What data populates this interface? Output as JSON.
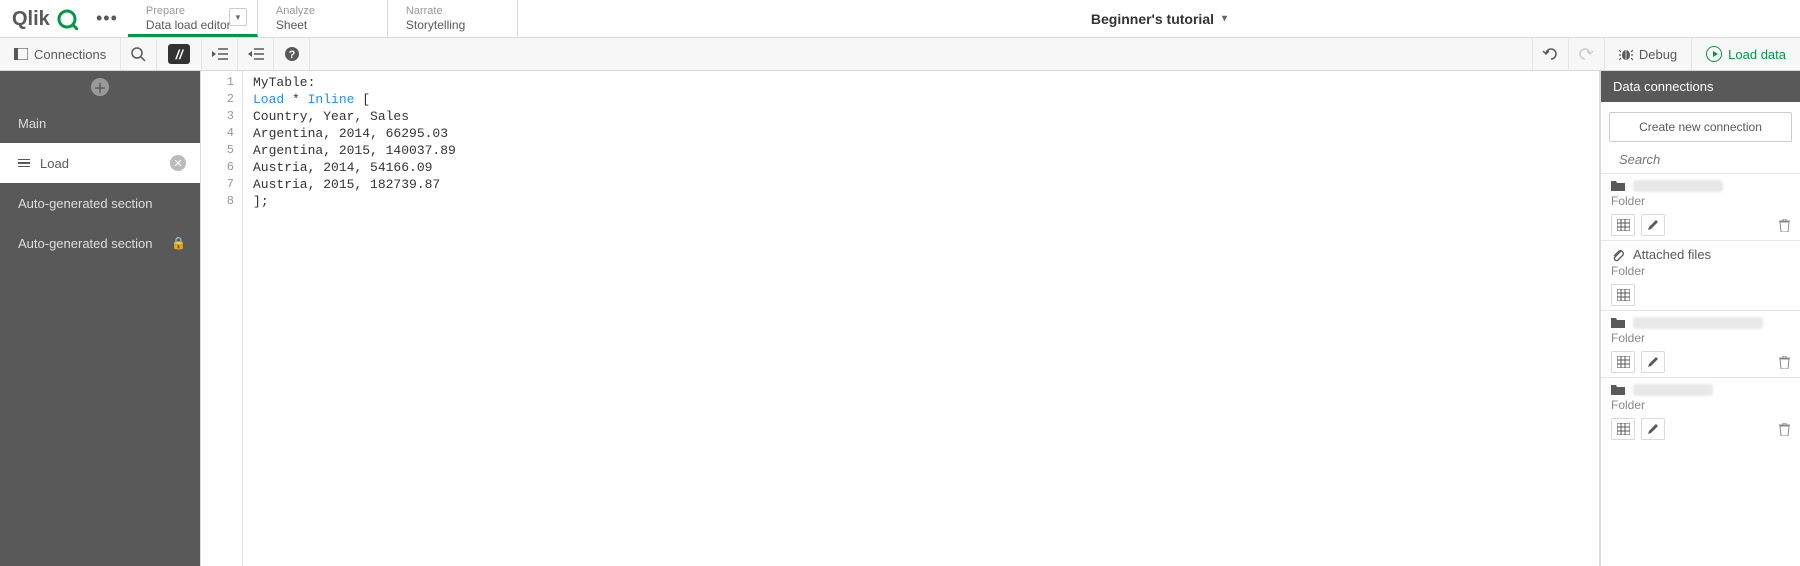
{
  "header": {
    "tabs": [
      {
        "small": "Prepare",
        "big": "Data load editor",
        "active": true,
        "hasChevron": true
      },
      {
        "small": "Analyze",
        "big": "Sheet",
        "active": false,
        "hasChevron": false
      },
      {
        "small": "Narrate",
        "big": "Storytelling",
        "active": false,
        "hasChevron": false
      }
    ],
    "title": "Beginner's tutorial"
  },
  "toolbar": {
    "connections": "Connections",
    "debug": "Debug",
    "loadData": "Load data"
  },
  "sections": {
    "items": [
      {
        "label": "Main",
        "selected": false
      },
      {
        "label": "Load",
        "selected": true
      },
      {
        "label": "Auto-generated section",
        "selected": false
      },
      {
        "label": "Auto-generated section",
        "selected": false,
        "locked": true
      }
    ]
  },
  "editor": {
    "lines": [
      {
        "n": "1",
        "raw": "MyTable:",
        "tokens": [
          [
            "txt",
            "MyTable"
          ],
          [
            "br",
            ":"
          ]
        ]
      },
      {
        "n": "2",
        "raw": "Load * Inline [",
        "tokens": [
          [
            "kw",
            "Load"
          ],
          [
            "txt",
            " * "
          ],
          [
            "kw",
            "Inline"
          ],
          [
            "txt",
            " "
          ],
          [
            "br",
            "["
          ]
        ]
      },
      {
        "n": "3",
        "raw": "Country, Year, Sales",
        "tokens": [
          [
            "txt",
            "Country, Year, Sales"
          ]
        ]
      },
      {
        "n": "4",
        "raw": "Argentina, 2014, 66295.03",
        "tokens": [
          [
            "txt",
            "Argentina, 2014, 66295.03"
          ]
        ]
      },
      {
        "n": "5",
        "raw": "Argentina, 2015, 140037.89",
        "tokens": [
          [
            "txt",
            "Argentina, 2015, 140037.89"
          ]
        ]
      },
      {
        "n": "6",
        "raw": "Austria, 2014, 54166.09",
        "tokens": [
          [
            "txt",
            "Austria, 2014, 54166.09"
          ]
        ]
      },
      {
        "n": "7",
        "raw": "Austria, 2015, 182739.87",
        "tokens": [
          [
            "txt",
            "Austria, 2015, 182739.87"
          ]
        ]
      },
      {
        "n": "8",
        "raw": "];",
        "tokens": [
          [
            "br",
            "]"
          ],
          [
            "txt",
            ";"
          ]
        ]
      }
    ]
  },
  "rpanel": {
    "header": "Data connections",
    "createBtn": "Create new connection",
    "searchPlaceholder": "Search",
    "connections": [
      {
        "redactedWidth": 90,
        "sub": "Folder",
        "nameVisible": false,
        "name": "",
        "edit": true,
        "del": true,
        "select": true
      },
      {
        "redactedWidth": 0,
        "sub": "Folder",
        "nameVisible": true,
        "name": "Attached files",
        "edit": false,
        "del": false,
        "select": true
      },
      {
        "redactedWidth": 130,
        "sub": "Folder",
        "nameVisible": false,
        "name": "",
        "edit": true,
        "del": true,
        "select": true
      },
      {
        "redactedWidth": 80,
        "sub": "Folder",
        "nameVisible": false,
        "name": "",
        "edit": true,
        "del": true,
        "select": true
      }
    ]
  }
}
